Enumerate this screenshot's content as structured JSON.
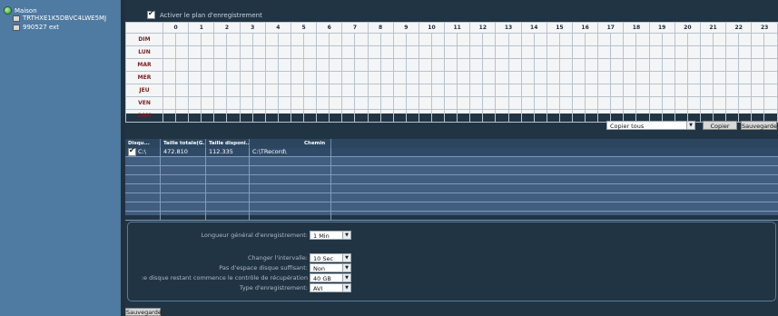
{
  "sidebar": {
    "root_label": "Maison",
    "devices": [
      "TRTHXE1K5DBVC4LWE5MJ",
      "990527 ext"
    ]
  },
  "schedule": {
    "enable_label": "Activer le plan d'enregistrement",
    "enabled": true,
    "hours": [
      "0",
      "1",
      "2",
      "3",
      "4",
      "5",
      "6",
      "7",
      "8",
      "9",
      "10",
      "11",
      "12",
      "13",
      "14",
      "15",
      "16",
      "17",
      "18",
      "19",
      "20",
      "21",
      "22",
      "23"
    ],
    "days": [
      "DIM",
      "LUN",
      "MAR",
      "MER",
      "JEU",
      "VEN",
      "SAM"
    ]
  },
  "copy": {
    "select_value": "Copier tous",
    "copy_button": "Copier",
    "save_button": "Sauvegarde"
  },
  "disks": {
    "columns": [
      "Disqu...",
      "Taille totale(G...",
      "Taille disponi...",
      "Chemin"
    ],
    "rows": [
      {
        "checked": true,
        "disk": "C:\\",
        "total": "472.810",
        "available": "112.335",
        "path": "C:\\TRecord\\"
      }
    ]
  },
  "settings": {
    "fields": [
      {
        "label": "Longueur général d'enregistrement:",
        "value": "1 Min"
      },
      {
        "label": "Changer l'intervalle:",
        "value": "10 Sec"
      },
      {
        "label": "Pas d'espace disque suffisant:",
        "value": "Non"
      },
      {
        "label": "e disque restant commence le contrôle de récupération:",
        "value": "40 GB"
      },
      {
        "label": "Type d'enregistrement:",
        "value": "AVI"
      }
    ]
  },
  "footer": {
    "save_button": "Sauvegarde"
  }
}
